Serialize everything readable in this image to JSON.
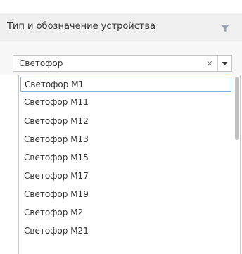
{
  "column_header": {
    "title": "Тип и обозначение устройства",
    "filter_icon": "filter-icon"
  },
  "filter": {
    "value": "Светофор",
    "clear_glyph": "×",
    "arrow_icon": "triangle-down-icon"
  },
  "dropdown": {
    "options": [
      "Светофор М1",
      "Светофор М11",
      "Светофор М12",
      "Светофор М13",
      "Светофор М15",
      "Светофор М17",
      "Светофор М19",
      "Светофор М2",
      "Светофор М21"
    ],
    "selected_index": 0
  },
  "colors": {
    "header_bg": "#f0f0f0",
    "selected_border": "#7fb1d9",
    "scroll_thumb": "#c1c1c1"
  }
}
